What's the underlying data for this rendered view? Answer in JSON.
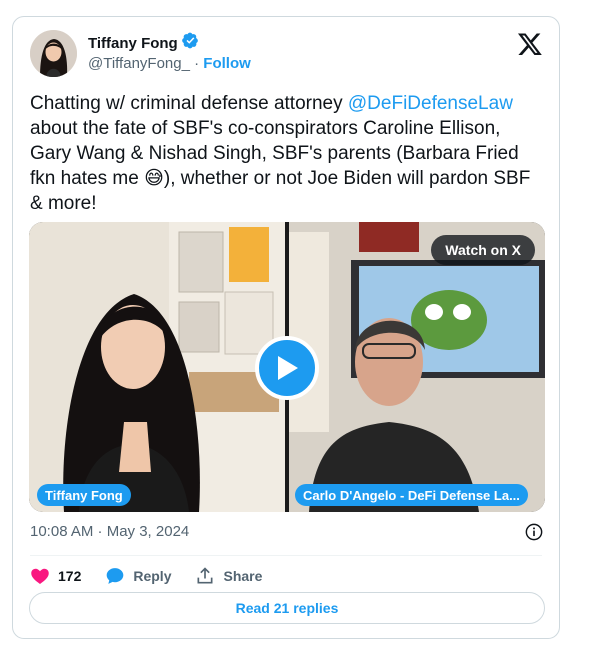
{
  "author": {
    "name": "Tiffany Fong",
    "handle": "@TiffanyFong_",
    "separator": " · ",
    "follow_label": "Follow"
  },
  "tweet": {
    "text_before_mention": "Chatting w/ criminal defense attorney ",
    "mention": "@DeFiDefenseLaw",
    "text_after_mention": " about the fate of SBF's co-conspirators Caroline Ellison, Gary Wang & Nishad Singh, SBF's parents (Barbara Fried fkn hates me ",
    "emoji": "😅",
    "text_end": "), whether or not Joe Biden will pardon SBF & more!"
  },
  "media": {
    "watch_label": "Watch on X",
    "left_label": "Tiffany Fong",
    "right_label": "Carlo D'Angelo - DeFi Defense La..."
  },
  "meta": {
    "timestamp": "10:08 AM · May 3, 2024"
  },
  "actions": {
    "likes": "172",
    "reply_label": "Reply",
    "share_label": "Share"
  },
  "footer": {
    "read_replies_label": "Read 21 replies"
  },
  "colors": {
    "accent": "#1d9bf0",
    "like": "#f91880",
    "text_secondary": "#536471"
  }
}
